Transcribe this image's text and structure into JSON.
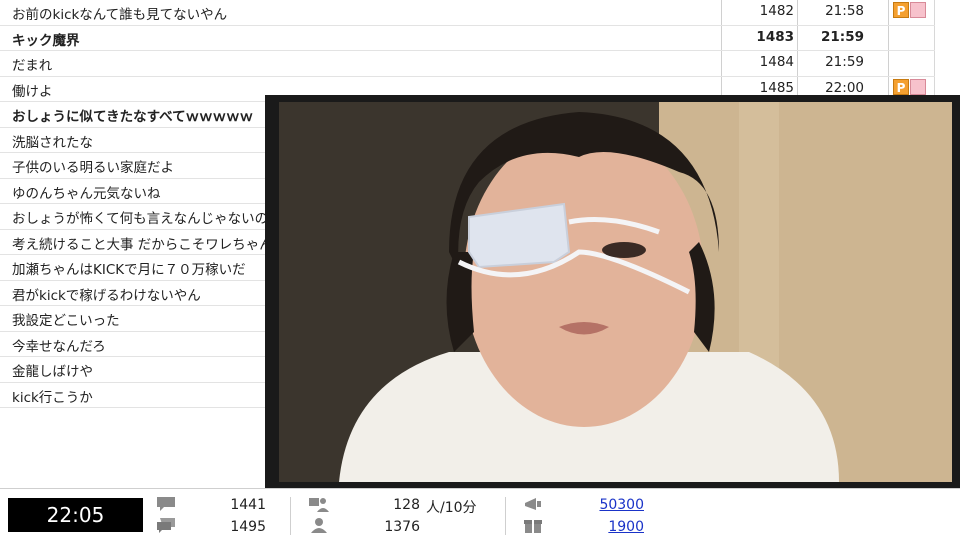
{
  "comments": [
    {
      "text": "お前のkickなんて誰も見てないやん",
      "num": "1482",
      "time": "21:58",
      "bold": false,
      "badge": true
    },
    {
      "text": "キック魔界",
      "num": "1483",
      "time": "21:59",
      "bold": true,
      "badge": false
    },
    {
      "text": "だまれ",
      "num": "1484",
      "time": "21:59",
      "bold": false,
      "badge": false
    },
    {
      "text": "働けよ",
      "num": "1485",
      "time": "22:00",
      "bold": false,
      "badge": true
    },
    {
      "text": "おしょうに似てきたなすべてｗｗｗｗｗ",
      "bold": true
    },
    {
      "text": "洗脳されたな",
      "bold": false
    },
    {
      "text": "子供のいる明るい家庭だよ",
      "bold": false
    },
    {
      "text": "ゆのんちゃん元気ないね",
      "bold": false
    },
    {
      "text": "おしょうが怖くて何も言えなんじゃないの",
      "bold": false
    },
    {
      "text": "考え続けること大事 だからこそワレちゃん",
      "bold": false
    },
    {
      "text": "加瀬ちゃんはKICKで月に７０万稼いだ",
      "bold": false
    },
    {
      "text": "君がkickで稼げるわけないやん",
      "bold": false
    },
    {
      "text": "我設定どこいった",
      "bold": false
    },
    {
      "text": "今幸せなんだろ",
      "bold": false
    },
    {
      "text": "金龍しばけや",
      "bold": false
    },
    {
      "text": "kick行こうか",
      "bold": false
    }
  ],
  "status": {
    "clock": "22:05",
    "comments_count": "1441",
    "comments_total": "1495",
    "viewers": "128",
    "viewers_unit": "人/10分",
    "visitors": "1376",
    "points": "50300",
    "gifts": "1900"
  },
  "icons": {
    "badge_p": "P"
  }
}
